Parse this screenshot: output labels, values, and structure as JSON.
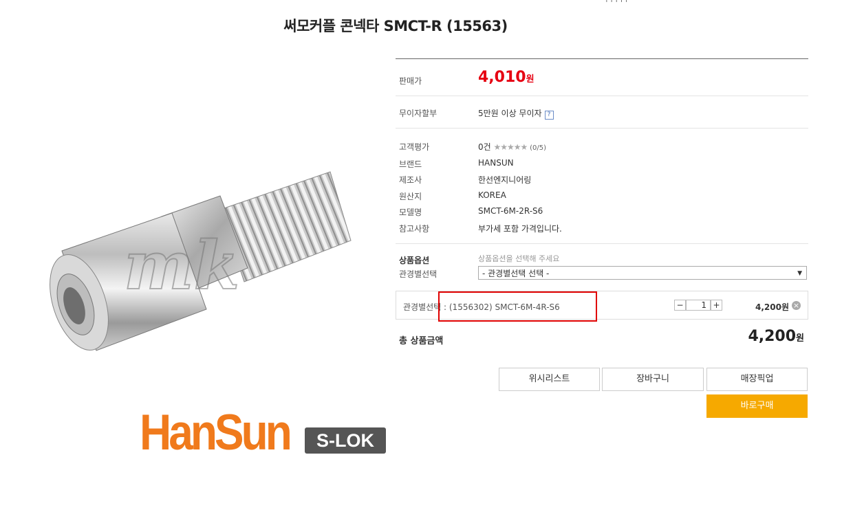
{
  "page_title": "써모커플 콘넥타 SMCT-R (15563)",
  "top_fragment": "| | | | |",
  "watermark": "mk",
  "logo": {
    "brand": "HanSun",
    "badge": "S-LOK"
  },
  "price": {
    "label": "판매가",
    "value": "4,010",
    "unit": "원"
  },
  "installment": {
    "label": "무이자할부",
    "value": "5만원 이상 무이자",
    "help": "?"
  },
  "details": {
    "rating_label": "고객평가",
    "rating_count": "0건",
    "rating_stars": "★★★★★",
    "rating_score": "(0/5)",
    "brand_label": "브랜드",
    "brand_value": "HANSUN",
    "maker_label": "제조사",
    "maker_value": "한선엔지니어링",
    "origin_label": "원산지",
    "origin_value": "KOREA",
    "model_label": "모델명",
    "model_value": "SMCT-6M-2R-S6",
    "note_label": "참고사항",
    "note_value": "부가세 포함 가격입니다."
  },
  "options": {
    "title": "상품옵션",
    "label": "관경별선택",
    "hint": "상품옵션을 선택해 주세요",
    "select_value": "- 관경별선택 선택 -"
  },
  "selected_option": {
    "text": "관경별선택 : (1556302) SMCT-6M-4R-S6",
    "minus": "−",
    "qty": "1",
    "plus": "+",
    "price": "4,200원",
    "remove": "×"
  },
  "total": {
    "label": "총 상품금액",
    "value": "4,200",
    "unit": "원"
  },
  "buttons": {
    "wishlist": "위시리스트",
    "cart": "장바구니",
    "pickup": "매장픽업",
    "buy_now": "바로구매"
  },
  "colors": {
    "price_red": "#e60012",
    "buy_orange": "#f6a900",
    "highlight_red": "#e00000"
  }
}
